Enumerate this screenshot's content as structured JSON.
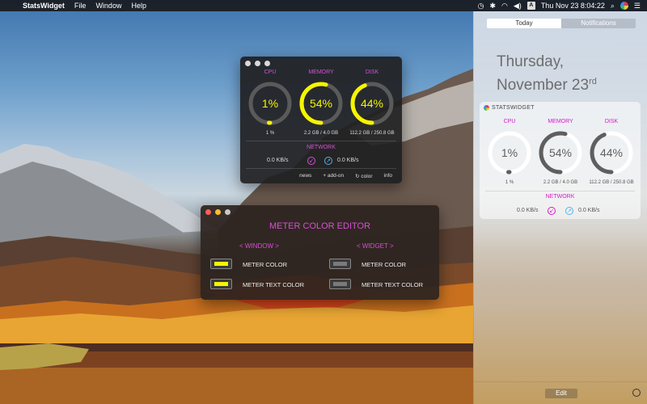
{
  "menubar": {
    "app_name": "StatsWidget",
    "menus": [
      "File",
      "Window",
      "Help"
    ],
    "clock": "Thu Nov 23  8:04:22",
    "input_source": "A"
  },
  "stats_window": {
    "cpu": {
      "label": "CPU",
      "value": "1%",
      "sub": "1 %",
      "fraction": 0.01
    },
    "memory": {
      "label": "MEMORY",
      "value": "54%",
      "sub": "2.2 GB / 4.0 GB",
      "fraction": 0.54
    },
    "disk": {
      "label": "DISK",
      "value": "44%",
      "sub": "112.2 GB / 250.8 GB",
      "fraction": 0.44
    },
    "network": {
      "label": "NETWORK",
      "down": "0.0 KB/s",
      "up": "0.0 KB/s"
    },
    "footer": {
      "news": "news",
      "addon": "+ add-on",
      "color": "color",
      "info": "info"
    },
    "meter_color": "#f5f500",
    "track_color": "#5a5a5a"
  },
  "color_editor": {
    "title": "METER COLOR EDITOR",
    "window_head": "< WINDOW >",
    "widget_head": "< WIDGET >",
    "window_meter_label": "METER COLOR",
    "window_text_label": "METER TEXT COLOR",
    "widget_meter_label": "METER COLOR",
    "widget_text_label": "METER TEXT COLOR",
    "window_meter_color": "#f5f500",
    "window_text_color": "#f5f500",
    "widget_meter_color": "#7a7a7a",
    "widget_text_color": "#7a7a7a"
  },
  "notification_center": {
    "tabs": [
      "Today",
      "Notifications"
    ],
    "date_line1": "Thursday,",
    "date_line2": "November 23",
    "date_suffix": "rd",
    "widget": {
      "title": "STATSWIDGET",
      "cpu": {
        "label": "CPU",
        "value": "1%",
        "sub": "1 %",
        "fraction": 0.01
      },
      "memory": {
        "label": "MEMORY",
        "value": "54%",
        "sub": "2.2 GB / 4.0 GB",
        "fraction": 0.54
      },
      "disk": {
        "label": "DISK",
        "value": "44%",
        "sub": "112.2 GB / 250.8 GB",
        "fraction": 0.44
      },
      "network": {
        "label": "NETWORK",
        "down": "0.0 KB/s",
        "up": "0.0 KB/s"
      },
      "meter_color": "#5f5f5f",
      "track_color": "#ffffff"
    },
    "edit_label": "Edit"
  }
}
